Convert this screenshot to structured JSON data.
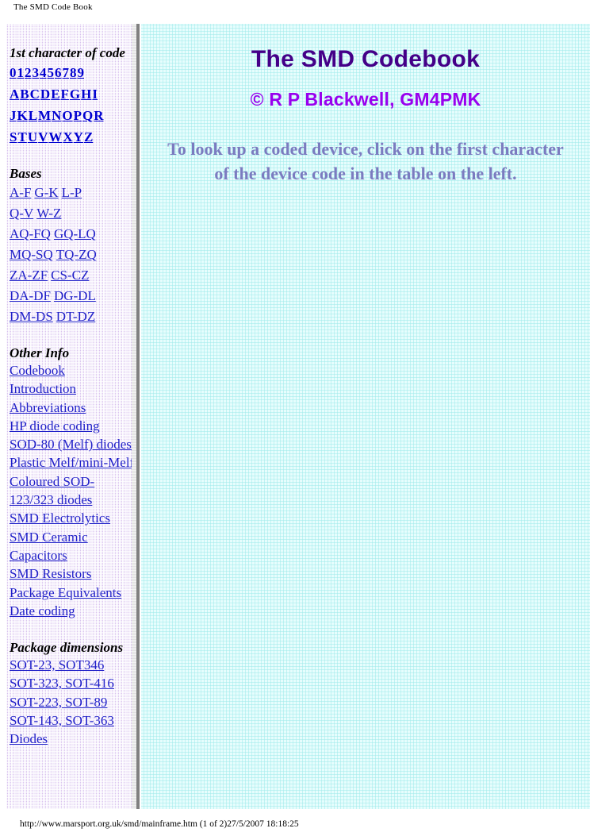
{
  "document": {
    "print_title": "The SMD Code Book",
    "footer": "http://www.marsport.org.uk/smd/mainframe.htm (1 of 2)27/5/2007 18:18:25"
  },
  "colors": {
    "nav_background": "#e3d4f2",
    "main_background": "#ddfbfb",
    "link": "#1f1fc8",
    "char_link": "#0000d0",
    "title": "#440088",
    "subtitle": "#9900ee",
    "instructions": "#7b7bc0",
    "divider": "#808080"
  },
  "sidebar": {
    "sections": [
      {
        "heading": "1st character of code",
        "rows": [
          [
            "0",
            "1",
            "2",
            "3",
            "4",
            "5",
            "6",
            "7",
            "8",
            "9"
          ],
          [
            "A",
            "B",
            "C",
            "D",
            "E",
            "F",
            "G",
            "H",
            "I"
          ],
          [
            "J",
            "K",
            "L",
            "M",
            "N",
            "O",
            "P",
            "Q",
            "R"
          ],
          [
            "S",
            "T",
            "U",
            "V",
            "W",
            "X",
            "Y",
            "Z"
          ]
        ]
      },
      {
        "heading": "Bases",
        "rows": [
          [
            "A-F",
            "G-K",
            "L-P"
          ],
          [
            "Q-V",
            "W-Z"
          ],
          [
            "AQ-FQ",
            "GQ-LQ"
          ],
          [
            "MQ-SQ",
            "TQ-ZQ"
          ],
          [
            "ZA-ZF",
            "CS-CZ"
          ],
          [
            "DA-DF",
            "DG-DL"
          ],
          [
            "DM-DS",
            "DT-DZ"
          ]
        ]
      },
      {
        "heading": "Other Info",
        "links": [
          "Codebook Introduction",
          "Abbreviations",
          "HP diode coding",
          "SOD-80 (Melf) diodes",
          "Plastic Melf/mini-Melf",
          "Coloured SOD-123/323 diodes",
          "SMD Electrolytics",
          "SMD Ceramic Capacitors",
          "SMD Resistors",
          "Package Equivalents",
          "Date coding"
        ]
      },
      {
        "heading": "Package dimensions",
        "links": [
          "SOT-23, SOT346",
          "SOT-323, SOT-416",
          "SOT-223, SOT-89",
          "SOT-143, SOT-363",
          "Diodes"
        ]
      }
    ]
  },
  "main": {
    "title": "The SMD Codebook",
    "subtitle": "© R P Blackwell, GM4PMK",
    "instructions": "To look up a coded device, click on the first character of the device code in the table on the left."
  }
}
